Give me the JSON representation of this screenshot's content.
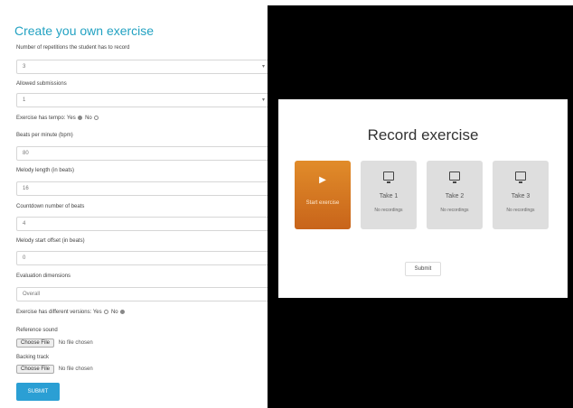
{
  "form": {
    "title": "Create you own exercise",
    "repetitions_label": "Number of repetitions the student has to record",
    "repetitions_value": "3",
    "submissions_label": "Allowed submissions",
    "submissions_value": "1",
    "tempo_label": "Exercise has tempo:",
    "tempo_yes": "Yes",
    "tempo_no": "No",
    "bpm_label": "Beats per minute (bpm)",
    "bpm_value": "80",
    "melody_length_label": "Melody length (in beats)",
    "melody_length_value": "16",
    "countdown_label": "Countdown number of beats",
    "countdown_value": "4",
    "melody_offset_label": "Melody start offset (in beats)",
    "melody_offset_value": "0",
    "evaluation_label": "Evaluation dimensions",
    "evaluation_value": "Overall",
    "versions_label": "Exercise has different versions:",
    "versions_yes": "Yes",
    "versions_no": "No",
    "reference_label": "Reference sound",
    "backing_label": "Backing track",
    "choose_file": "Choose File",
    "no_file": "No file chosen",
    "submit_label": "SUBMIT"
  },
  "recorder": {
    "title": "Record exercise",
    "start_label": "Start exercise",
    "takes": [
      {
        "label": "Take 1",
        "status": "No recordings"
      },
      {
        "label": "Take 2",
        "status": "No recordings"
      },
      {
        "label": "Take 3",
        "status": "No recordings"
      }
    ],
    "submit_label": "Submit"
  },
  "colors": {
    "accent": "#23a2c2",
    "submit_button": "#2b9fd4",
    "start_tile": "#d97a22",
    "take_tile": "#dedede"
  },
  "icons": {
    "play": "play-icon",
    "take": "monitor-record-icon"
  }
}
